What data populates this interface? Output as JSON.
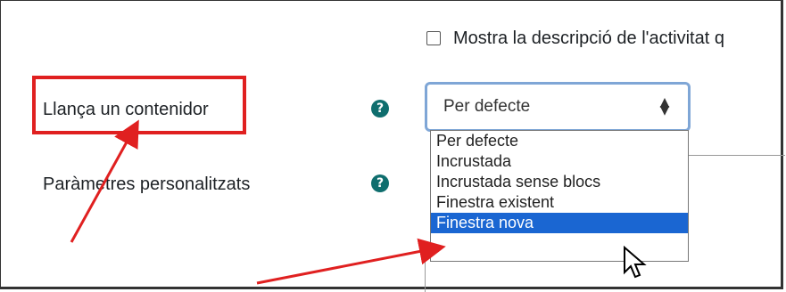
{
  "form": {
    "show_description_label": "Mostra la descripció de l'activitat q",
    "launch_container": {
      "label": "Llança un contenidor",
      "help_icon": "question-circle-icon",
      "selected": "Per defecte",
      "options": [
        "Per defecte",
        "Incrustada",
        "Incrustada sense blocs",
        "Finestra existent",
        "Finestra nova"
      ],
      "highlighted_option": "Finestra nova"
    },
    "custom_params": {
      "label": "Paràmetres personalitzats",
      "help_icon": "question-circle-icon"
    }
  },
  "annotations": {
    "highlight_color": "#e02020",
    "arrow_color": "#e02020"
  },
  "colors": {
    "help_icon": "#0f6e6e",
    "focus_border": "#7fa6d6",
    "selected_option": "#1a66d2"
  }
}
